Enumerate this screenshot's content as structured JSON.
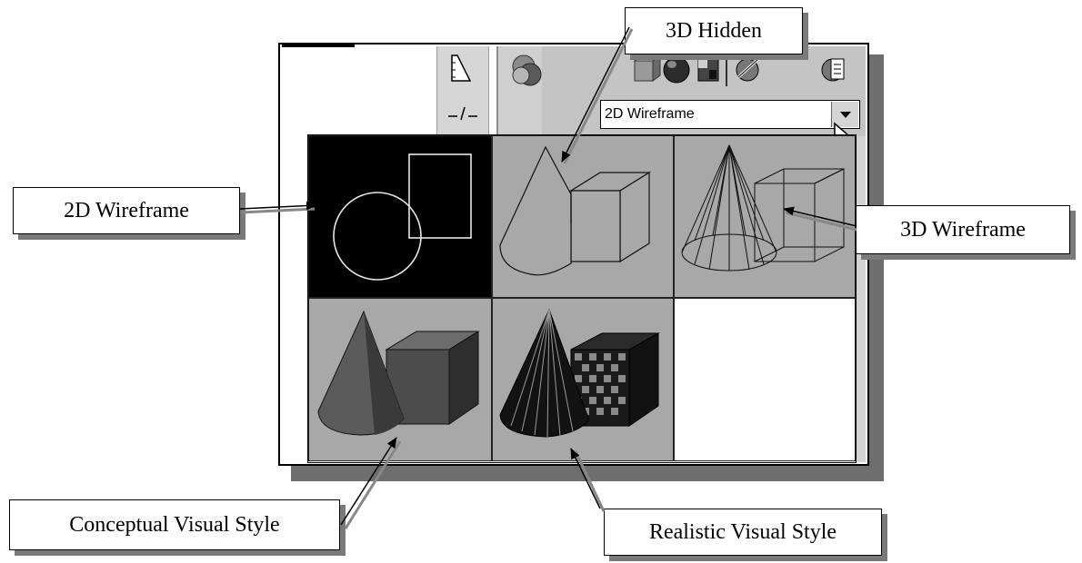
{
  "dropdown": {
    "selected_value": "2D Wireframe",
    "arrow_icon": "chevron-down-icon"
  },
  "toolbar": {
    "left_icons": [
      "ruler-icon",
      "dashed-line-icon"
    ],
    "visual_style_icon": "visual-styles-manager-icon",
    "right_icons": [
      "hidden-style-icon",
      "realistic-style-icon",
      "conceptual-style-icon",
      "edge-settings-icon",
      "face-settings-icon"
    ]
  },
  "styles": [
    {
      "key": "2d-wireframe",
      "thumbnail": "2D wireframe circle and rectangle"
    },
    {
      "key": "3d-hidden",
      "thumbnail": "hidden-line cone and box"
    },
    {
      "key": "3d-wireframe",
      "thumbnail": "wireframe cone and box"
    },
    {
      "key": "conceptual",
      "thumbnail": "shaded cone and box"
    },
    {
      "key": "realistic",
      "thumbnail": "textured cone and box"
    },
    {
      "key": "empty",
      "thumbnail": ""
    }
  ],
  "callouts": {
    "hidden": "3D Hidden",
    "wireframe2d": "2D Wireframe",
    "wireframe3d": "3D Wireframe",
    "conceptual": "Conceptual Visual Style",
    "realistic": "Realistic Visual Style"
  },
  "colors": {
    "thumb_dark": "#000000",
    "thumb_gray": "#a8a8a8",
    "panel_gray": "#c4c4c4"
  }
}
